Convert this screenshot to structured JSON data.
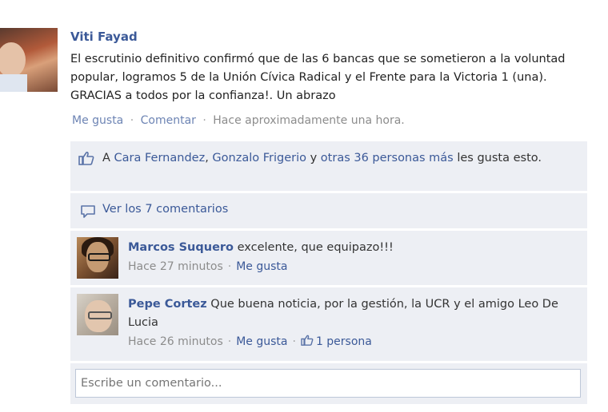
{
  "post": {
    "author": "Viti Fayad",
    "text": "El escrutinio definitivo confirmó que de las 6 bancas que se sometieron a la voluntad popular, logramos 5 de la Unión Cívica Radical y el Frente para la Victoria 1 (una). GRACIAS a todos por la confianza!. Un abrazo",
    "like_label": "Me gusta",
    "comment_label": "Comentar",
    "separator": "·",
    "time": "Hace aproximadamente una hora."
  },
  "likes": {
    "prefix": "A",
    "person1": "Cara Fernandez",
    "comma": ",",
    "person2": "Gonzalo Frigerio",
    "connector": "y",
    "others": "otras 36 personas más",
    "suffix": "les gusta esto."
  },
  "view_comments": {
    "label": "Ver los 7 comentarios"
  },
  "comments": [
    {
      "author": "Marcos Suquero",
      "text": "excelente, que equipazo!!!",
      "time": "Hace 27 minutos",
      "like_label": "Me gusta"
    },
    {
      "author": "Pepe Cortez",
      "text": "Que buena noticia, por la gestión, la UCR y el amigo Leo De Lucia",
      "time": "Hace 26 minutos",
      "like_label": "Me gusta",
      "like_count": "1 persona"
    }
  ],
  "write_comment": {
    "placeholder": "Escribe un comentario..."
  },
  "colors": {
    "link": "#3b5998",
    "box_bg": "#edeff4",
    "meta": "#8c8c8c"
  },
  "icons": {
    "likes": "thumbs-up-icon",
    "view_comments": "comment-bubble-icon"
  }
}
